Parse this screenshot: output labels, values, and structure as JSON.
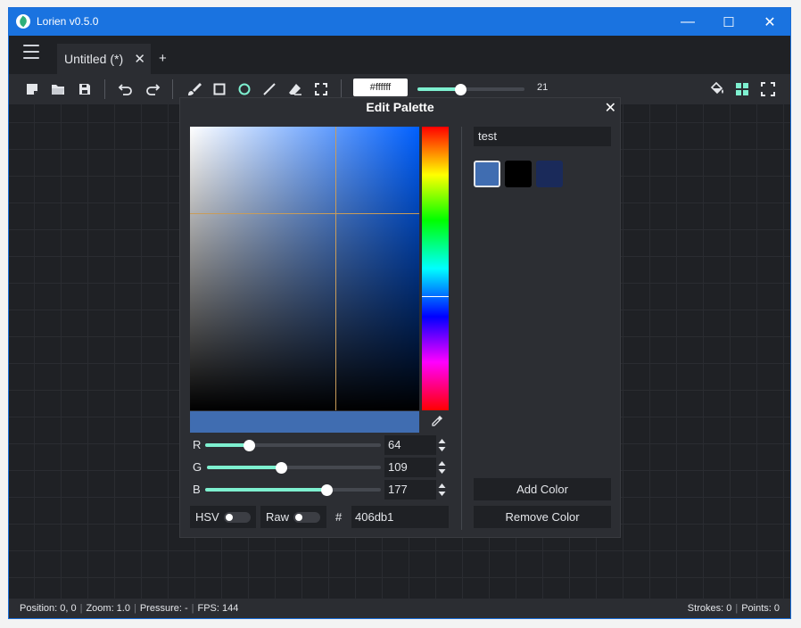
{
  "window": {
    "title": "Lorien v0.5.0",
    "minimize": "—",
    "maximize": "☐",
    "close": "✕"
  },
  "tabs": [
    {
      "label": "Untitled (*)",
      "close": "✕"
    }
  ],
  "new_tab": "+",
  "toolbar": {
    "color_hex": "#ffffff",
    "brush_size": "21",
    "brush_size_fraction": 0.4
  },
  "status": {
    "position": "Position: 0, 0",
    "zoom": "Zoom: 1.0",
    "pressure": "Pressure: -",
    "fps": "FPS: 144",
    "strokes": "Strokes: 0",
    "points": "Points: 0",
    "divider": "|"
  },
  "dialog": {
    "title": "Edit Palette",
    "close": "✕",
    "palette_name": "test",
    "current_color": "#406db1",
    "swatches": [
      "#406db1",
      "#000000",
      "#1a2a5a"
    ],
    "channels": [
      {
        "label": "R",
        "value": "64",
        "fraction": 0.251
      },
      {
        "label": "G",
        "value": "109",
        "fraction": 0.427
      },
      {
        "label": "B",
        "value": "177",
        "fraction": 0.694
      }
    ],
    "hsv_label": "HSV",
    "raw_label": "Raw",
    "hash": "#",
    "hex_value": "406db1",
    "add_color": "Add Color",
    "remove_color": "Remove Color"
  },
  "colors": {
    "accent": "#7ef0d0",
    "titlebar": "#1a73e0",
    "background": "#1f2125",
    "panel": "#2b2d32"
  }
}
